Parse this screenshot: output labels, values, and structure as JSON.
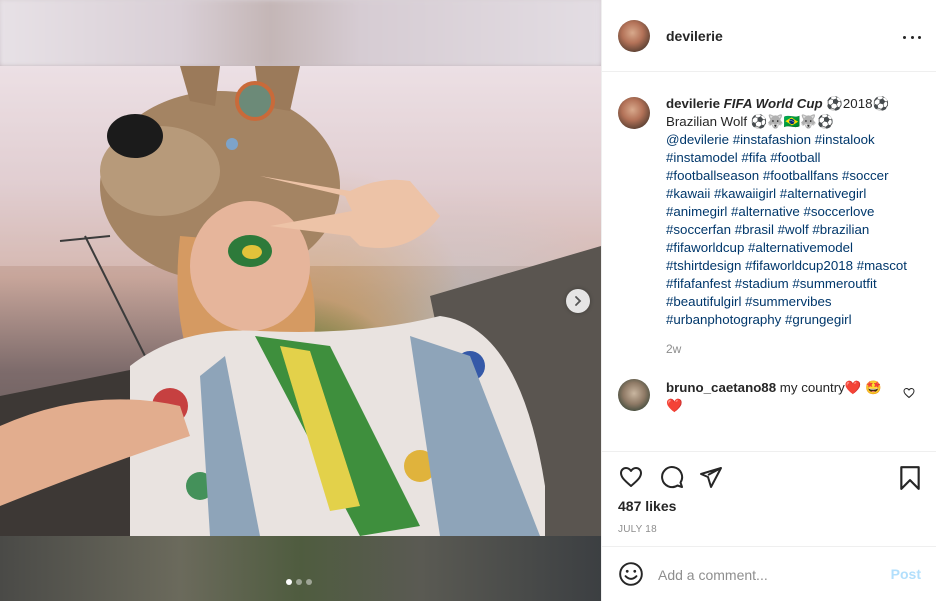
{
  "post": {
    "author": "devilerie",
    "caption": {
      "username": "devilerie",
      "title_part": "FIFA World Cup",
      "line1_rest": " ⚽2018⚽",
      "line2": "Brazilian Wolf ⚽🐺🇧🇷🐺⚽",
      "hashtags": "@devilerie #instafashion #instalook #instamodel #fifa #football #footballseason #footballfans #soccer #kawaii #kawaiigirl #alternativegirl #animegirl #alternative #soccerlove #soccerfan #brasil #wolf #brazilian #fifaworldcup #alternativemodel #tshirtdesign #fifaworldcup2018 #mascot #fifafanfest #stadium #summeroutfit #beautifulgirl #summervibes #urbanphotography #grungegirl",
      "time": "2w"
    },
    "comments": [
      {
        "username": "bruno_caetano88",
        "text": " my country❤️ 🤩❤️"
      }
    ],
    "likes": "487 likes",
    "date": "JULY 18",
    "add_comment": {
      "placeholder": "Add a comment...",
      "post_label": "Post"
    },
    "carousel": {
      "current": 1,
      "total": 3
    }
  }
}
